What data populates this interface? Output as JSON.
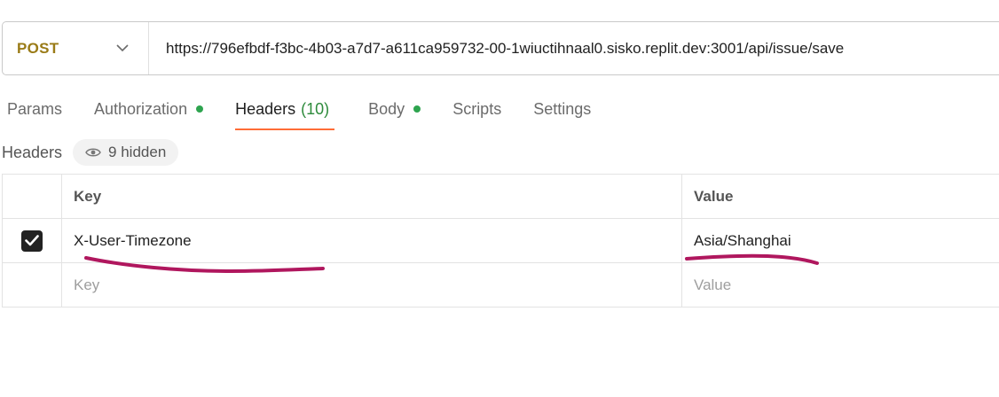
{
  "request": {
    "method": "POST",
    "url": "https://796efbdf-f3bc-4b03-a7d7-a611ca959732-00-1wiuctihnaal0.sisko.replit.dev:3001/api/issue/save"
  },
  "tabs": [
    {
      "label": "Params"
    },
    {
      "label": "Authorization"
    },
    {
      "label": "Headers",
      "count": "(10)"
    },
    {
      "label": "Body"
    },
    {
      "label": "Scripts"
    },
    {
      "label": "Settings"
    }
  ],
  "headers_section": {
    "title": "Headers",
    "hidden_label": "9 hidden"
  },
  "table": {
    "columns": {
      "key": "Key",
      "value": "Value"
    },
    "rows": [
      {
        "checked": true,
        "key": "X-User-Timezone",
        "value": "Asia/Shanghai"
      }
    ],
    "placeholder": {
      "key": "Key",
      "value": "Value"
    }
  },
  "colors": {
    "method": "#9a7b17",
    "active_tab_underline": "#ff6c37",
    "status_dot": "#2ea44f",
    "annotation_stroke": "#b0175e"
  },
  "icons": {
    "method_dropdown": "chevron-down-icon",
    "hidden_toggle": "eye-icon",
    "checkbox": "check-icon"
  }
}
